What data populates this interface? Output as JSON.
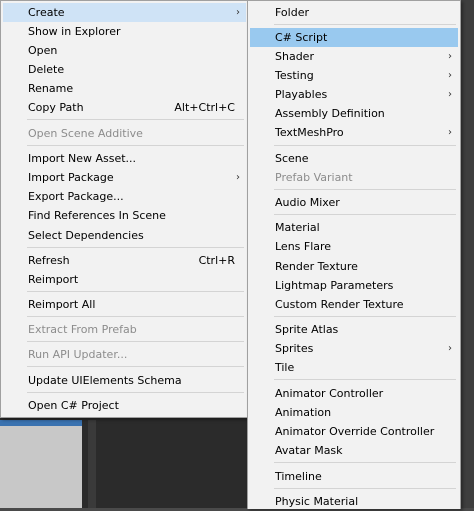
{
  "main_menu": {
    "items": [
      {
        "label": "Create",
        "shortcut": "",
        "arrow": "›",
        "disabled": false
      },
      {
        "label": "Show in Explorer",
        "shortcut": "",
        "arrow": "",
        "disabled": false
      },
      {
        "label": "Open",
        "shortcut": "",
        "arrow": "",
        "disabled": false
      },
      {
        "label": "Delete",
        "shortcut": "",
        "arrow": "",
        "disabled": false
      },
      {
        "label": "Rename",
        "shortcut": "",
        "arrow": "",
        "disabled": false
      },
      {
        "label": "Copy Path",
        "shortcut": "Alt+Ctrl+C",
        "arrow": "",
        "disabled": false
      },
      {
        "label": "Open Scene Additive",
        "shortcut": "",
        "arrow": "",
        "disabled": true
      },
      {
        "label": "Import New Asset...",
        "shortcut": "",
        "arrow": "",
        "disabled": false
      },
      {
        "label": "Import Package",
        "shortcut": "",
        "arrow": "›",
        "disabled": false
      },
      {
        "label": "Export Package...",
        "shortcut": "",
        "arrow": "",
        "disabled": false
      },
      {
        "label": "Find References In Scene",
        "shortcut": "",
        "arrow": "",
        "disabled": false
      },
      {
        "label": "Select Dependencies",
        "shortcut": "",
        "arrow": "",
        "disabled": false
      },
      {
        "label": "Refresh",
        "shortcut": "Ctrl+R",
        "arrow": "",
        "disabled": false
      },
      {
        "label": "Reimport",
        "shortcut": "",
        "arrow": "",
        "disabled": false
      },
      {
        "label": "Reimport All",
        "shortcut": "",
        "arrow": "",
        "disabled": false
      },
      {
        "label": "Extract From Prefab",
        "shortcut": "",
        "arrow": "",
        "disabled": true
      },
      {
        "label": "Run API Updater...",
        "shortcut": "",
        "arrow": "",
        "disabled": true
      },
      {
        "label": "Update UIElements Schema",
        "shortcut": "",
        "arrow": "",
        "disabled": false
      },
      {
        "label": "Open C# Project",
        "shortcut": "",
        "arrow": "",
        "disabled": false
      }
    ]
  },
  "sub_menu": {
    "items": [
      {
        "label": "Folder",
        "arrow": "",
        "disabled": false
      },
      {
        "label": "C# Script",
        "arrow": "",
        "disabled": false
      },
      {
        "label": "Shader",
        "arrow": "›",
        "disabled": false
      },
      {
        "label": "Testing",
        "arrow": "›",
        "disabled": false
      },
      {
        "label": "Playables",
        "arrow": "›",
        "disabled": false
      },
      {
        "label": "Assembly Definition",
        "arrow": "",
        "disabled": false
      },
      {
        "label": "TextMeshPro",
        "arrow": "›",
        "disabled": false
      },
      {
        "label": "Scene",
        "arrow": "",
        "disabled": false
      },
      {
        "label": "Prefab Variant",
        "arrow": "",
        "disabled": true
      },
      {
        "label": "Audio Mixer",
        "arrow": "",
        "disabled": false
      },
      {
        "label": "Material",
        "arrow": "",
        "disabled": false
      },
      {
        "label": "Lens Flare",
        "arrow": "",
        "disabled": false
      },
      {
        "label": "Render Texture",
        "arrow": "",
        "disabled": false
      },
      {
        "label": "Lightmap Parameters",
        "arrow": "",
        "disabled": false
      },
      {
        "label": "Custom Render Texture",
        "arrow": "",
        "disabled": false
      },
      {
        "label": "Sprite Atlas",
        "arrow": "",
        "disabled": false
      },
      {
        "label": "Sprites",
        "arrow": "›",
        "disabled": false
      },
      {
        "label": "Tile",
        "arrow": "",
        "disabled": false
      },
      {
        "label": "Animator Controller",
        "arrow": "",
        "disabled": false
      },
      {
        "label": "Animation",
        "arrow": "",
        "disabled": false
      },
      {
        "label": "Animator Override Controller",
        "arrow": "",
        "disabled": false
      },
      {
        "label": "Avatar Mask",
        "arrow": "",
        "disabled": false
      },
      {
        "label": "Timeline",
        "arrow": "",
        "disabled": false
      },
      {
        "label": "Physic Material",
        "arrow": "",
        "disabled": false
      }
    ]
  },
  "colors": {
    "menu_bg": "#f2f2f2",
    "highlight": "#99c9ef",
    "disabled_text": "#8c8c8c"
  }
}
